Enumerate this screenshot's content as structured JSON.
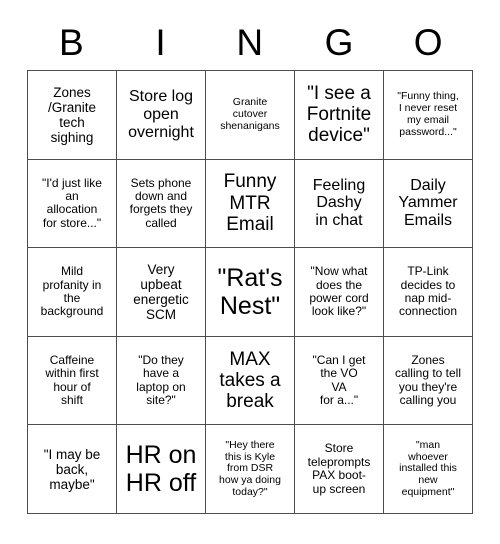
{
  "card": {
    "header_letters": [
      "B",
      "I",
      "N",
      "G",
      "O"
    ],
    "rows": [
      [
        {
          "text": "Zones\n/Granite\ntech\nsighing",
          "size": "fs-md"
        },
        {
          "text": "Store log\nopen\novernight",
          "size": "fs-lg"
        },
        {
          "text": "Granite\ncutover\nshenanigans",
          "size": "fs-xs"
        },
        {
          "text": "\"I see a\nFortnite\ndevice\"",
          "size": "fs-xl"
        },
        {
          "text": "\"Funny thing,\nI never reset\nmy email\npassword...\"",
          "size": "fs-xs"
        }
      ],
      [
        {
          "text": "\"I'd just like\nan\nallocation\nfor store...\"",
          "size": "fs-sm"
        },
        {
          "text": "Sets phone\ndown and\nforgets they\ncalled",
          "size": "fs-sm"
        },
        {
          "text": "Funny\nMTR\nEmail",
          "size": "fs-xl"
        },
        {
          "text": "Feeling\nDashy\nin chat",
          "size": "fs-lg"
        },
        {
          "text": "Daily\nYammer\nEmails",
          "size": "fs-lg"
        }
      ],
      [
        {
          "text": "Mild\nprofanity in\nthe\nbackground",
          "size": "fs-sm"
        },
        {
          "text": "Very\nupbeat\nenergetic\nSCM",
          "size": "fs-md"
        },
        {
          "text": "\"Rat's\nNest\"",
          "size": "fs-xxl"
        },
        {
          "text": "\"Now what\ndoes the\npower cord\nlook like?\"",
          "size": "fs-sm"
        },
        {
          "text": "TP-Link\ndecides to\nnap mid-\nconnection",
          "size": "fs-sm"
        }
      ],
      [
        {
          "text": "Caffeine\nwithin first\nhour of\nshift",
          "size": "fs-sm"
        },
        {
          "text": "\"Do they\nhave a\nlaptop on\nsite?\"",
          "size": "fs-sm"
        },
        {
          "text": "MAX\ntakes a\nbreak",
          "size": "fs-xl"
        },
        {
          "text": "\"Can I get\nthe VO\nVA\nfor a...\"",
          "size": "fs-sm"
        },
        {
          "text": "Zones\ncalling to tell\nyou they're\ncalling you",
          "size": "fs-sm"
        }
      ],
      [
        {
          "text": "\"I may be\nback,\nmaybe\"",
          "size": "fs-md"
        },
        {
          "text": "HR on\nHR off",
          "size": "fs-xxl"
        },
        {
          "text": "\"Hey there\nthis is Kyle\nfrom DSR\nhow ya doing\ntoday?\"",
          "size": "fs-xs"
        },
        {
          "text": "Store\nteleprompts\nPAX boot-\nup screen",
          "size": "fs-sm"
        },
        {
          "text": "\"man\nwhoever\ninstalled this\nnew\nequipment\"",
          "size": "fs-xs"
        }
      ]
    ]
  }
}
